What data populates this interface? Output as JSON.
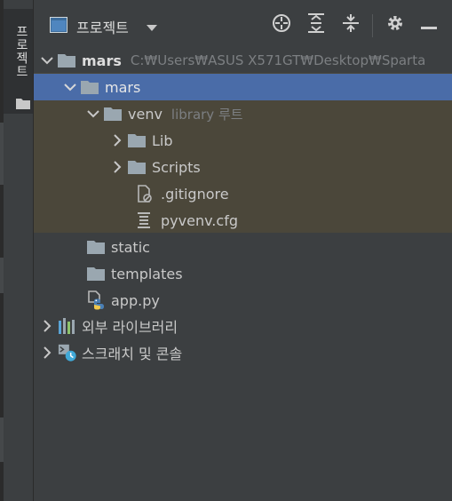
{
  "strip": {
    "tab_label": "프로젝트"
  },
  "header": {
    "view_label": "프로젝트"
  },
  "tree": {
    "root": {
      "name": "mars",
      "path": "C:₩Users₩ASUS X571GT₩Desktop₩Sparta"
    },
    "mars_dir": {
      "name": "mars"
    },
    "venv": {
      "name": "venv",
      "note": "library 루트"
    },
    "lib": {
      "name": "Lib"
    },
    "scripts": {
      "name": "Scripts"
    },
    "gitignore": {
      "name": ".gitignore"
    },
    "pyvenv": {
      "name": "pyvenv.cfg"
    },
    "static": {
      "name": "static"
    },
    "templates": {
      "name": "templates"
    },
    "app": {
      "name": "app.py"
    },
    "external_libs": {
      "name": "외부 라이브러리"
    },
    "scratches": {
      "name": "스크래치 및 콘솔"
    }
  },
  "colors": {
    "selection": "#4a6ca8",
    "library_root_bg": "#4b473a",
    "folder": "#9aa7b0",
    "panel_bg": "#3c3f41"
  },
  "icons": {
    "view": "window-icon",
    "locate": "crosshair-icon",
    "expand": "expand-all-icon",
    "collapse": "collapse-all-icon",
    "settings": "gear-icon",
    "hide": "minimize-icon"
  }
}
